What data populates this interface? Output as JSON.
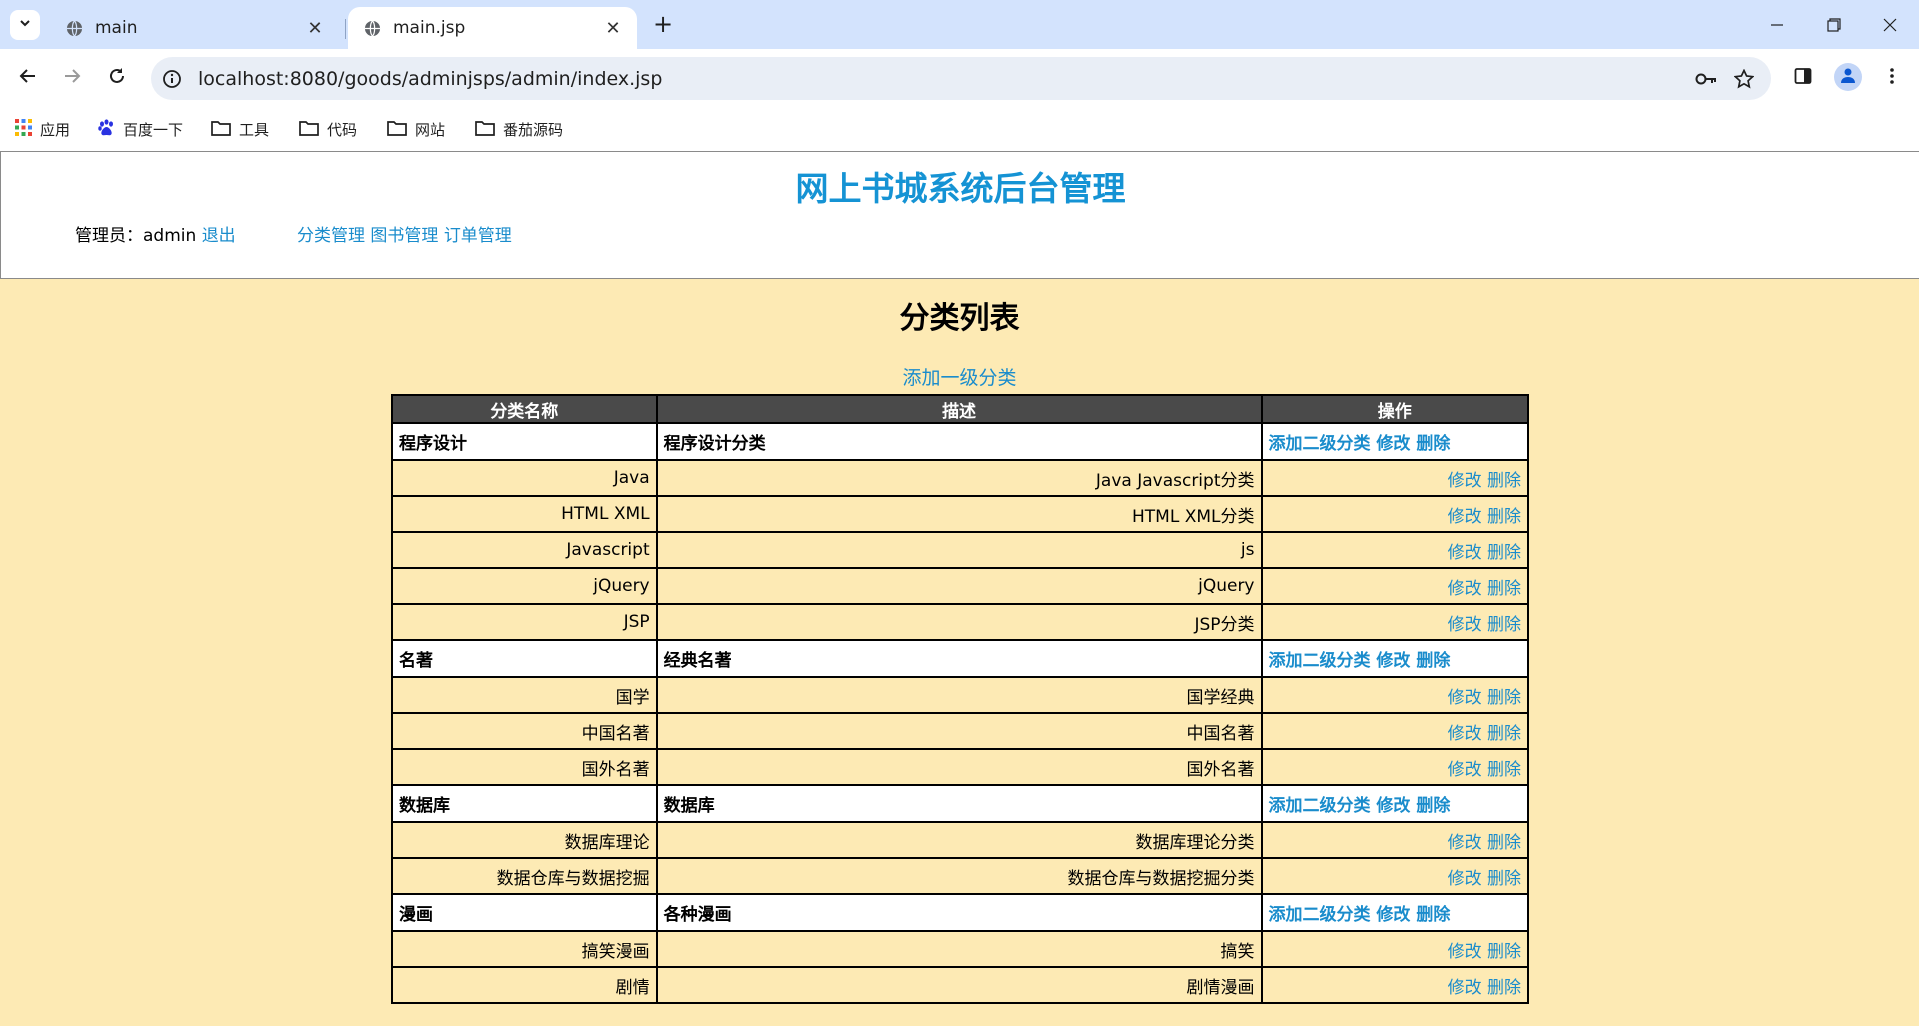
{
  "browser": {
    "tabs": [
      {
        "label": "main",
        "active": false
      },
      {
        "label": "main.jsp",
        "active": true
      }
    ],
    "url": "localhost:8080/goods/adminjsps/admin/index.jsp",
    "bookmarks": [
      "应用",
      "百度一下",
      "工具",
      "代码",
      "网站",
      "番茄源码"
    ]
  },
  "page": {
    "site_title": "网上书城系统后台管理",
    "admin_label": "管理员：admin",
    "logout": "退出",
    "nav": [
      "分类管理",
      "图书管理",
      "订单管理"
    ],
    "list_title": "分类列表",
    "add_top_level": "添加一级分类",
    "columns": [
      "分类名称",
      "描述",
      "操作"
    ],
    "ops": {
      "add_child": "添加二级分类",
      "edit": "修改",
      "delete": "删除"
    },
    "categories": [
      {
        "name": "程序设计",
        "desc": "程序设计分类",
        "children": [
          {
            "name": "Java",
            "desc": "Java Javascript分类"
          },
          {
            "name": "HTML XML",
            "desc": "HTML XML分类"
          },
          {
            "name": "Javascript",
            "desc": "js"
          },
          {
            "name": "jQuery",
            "desc": "jQuery"
          },
          {
            "name": "JSP",
            "desc": "JSP分类"
          }
        ]
      },
      {
        "name": "名著",
        "desc": "经典名著",
        "children": [
          {
            "name": "国学",
            "desc": "国学经典"
          },
          {
            "name": "中国名著",
            "desc": "中国名著"
          },
          {
            "name": "国外名著",
            "desc": "国外名著"
          }
        ]
      },
      {
        "name": "数据库",
        "desc": "数据库",
        "children": [
          {
            "name": "数据库理论",
            "desc": "数据库理论分类"
          },
          {
            "name": "数据仓库与数据挖掘",
            "desc": "数据仓库与数据挖掘分类"
          }
        ]
      },
      {
        "name": "漫画",
        "desc": "各种漫画",
        "children": [
          {
            "name": "搞笑漫画",
            "desc": "搞笑"
          },
          {
            "name": "剧情",
            "desc": "剧情漫画"
          }
        ]
      }
    ]
  },
  "colors": {
    "link": "#1a8ccc",
    "title": "#1593d4",
    "page_bg": "#fdeab4",
    "header_row": "#4a4a4a"
  }
}
